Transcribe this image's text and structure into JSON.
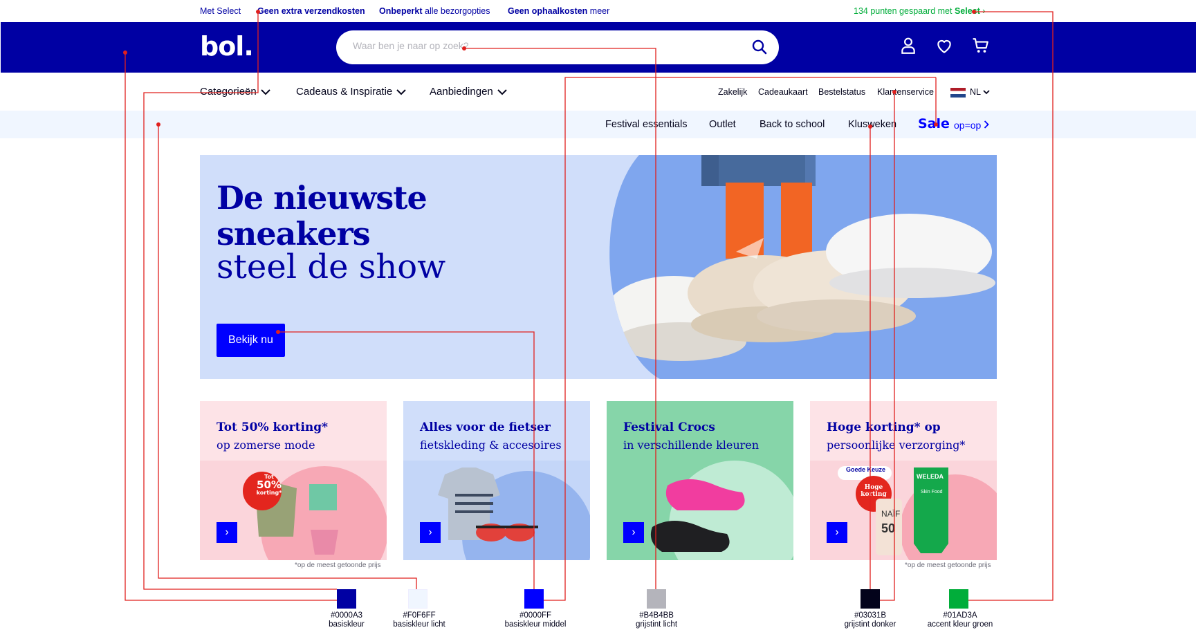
{
  "promo": {
    "select": "Met Select",
    "p1_bold": "Geen extra verzendkosten",
    "p2_bold": "Onbeperkt",
    "p2_rest": " alle bezorgopties",
    "p3_bold": "Geen ophaalkosten",
    "p3_rest": " meer",
    "points": "134 punten gespaard met ",
    "points_brand": "Select",
    "points_arrow": "›"
  },
  "header": {
    "logo": "bol.",
    "search_placeholder": "Waar ben je naar op zoek?"
  },
  "nav": {
    "categories": [
      "Categorieën",
      "Cadeaus & Inspiratie",
      "Aanbiedingen"
    ],
    "utility": [
      "Zakelijk",
      "Cadeaukaart",
      "Bestelstatus",
      "Klantenservice"
    ],
    "lang": "NL"
  },
  "subnav": {
    "links": [
      "Festival essentials",
      "Outlet",
      "Back to school",
      "Klusweken"
    ],
    "sale": "Sale",
    "opop": "op=op"
  },
  "hero": {
    "line1": "De nieuwste",
    "line2": "sneakers",
    "line3": "steel de show",
    "button": "Bekijk nu"
  },
  "tiles": [
    {
      "title": "Tot 50% korting*",
      "subtitle": "op zomerse mode",
      "badge_top": "Tot",
      "badge_mid": "50%",
      "badge_bot": "korting*"
    },
    {
      "title": "Alles voor de fietser",
      "subtitle": "fietskleding & accesoires"
    },
    {
      "title": "Festival Crocs",
      "subtitle": "in verschillende kleuren"
    },
    {
      "title": "Hoge korting* op",
      "subtitle": "persoonlijke verzorging*",
      "label": "Goede Keuze",
      "badge": "Hoge korting",
      "brand": "WELEDA",
      "product": "Skin Food",
      "spf": "50",
      "naif": "NAÏF"
    }
  ],
  "footnote": "*op de meest getoonde prijs",
  "swatches": [
    {
      "hex": "#0000A3",
      "name": "basiskleur",
      "color": "#0000A3"
    },
    {
      "hex": "#F0F6FF",
      "name": "basiskleur licht",
      "color": "#F0F6FF"
    },
    {
      "hex": "#0000FF",
      "name": "basiskleur middel",
      "color": "#0000FF"
    },
    {
      "hex": "#B4B4BB",
      "name": "grijstint licht",
      "color": "#B4B4BB"
    },
    {
      "hex": "#03031B",
      "name": "grijstint donker",
      "color": "#03031B"
    },
    {
      "hex": "#01AD3A",
      "name": "accent kleur groen",
      "color": "#01AD3A"
    }
  ],
  "colors": {
    "annotation_line": "#E0201E"
  }
}
